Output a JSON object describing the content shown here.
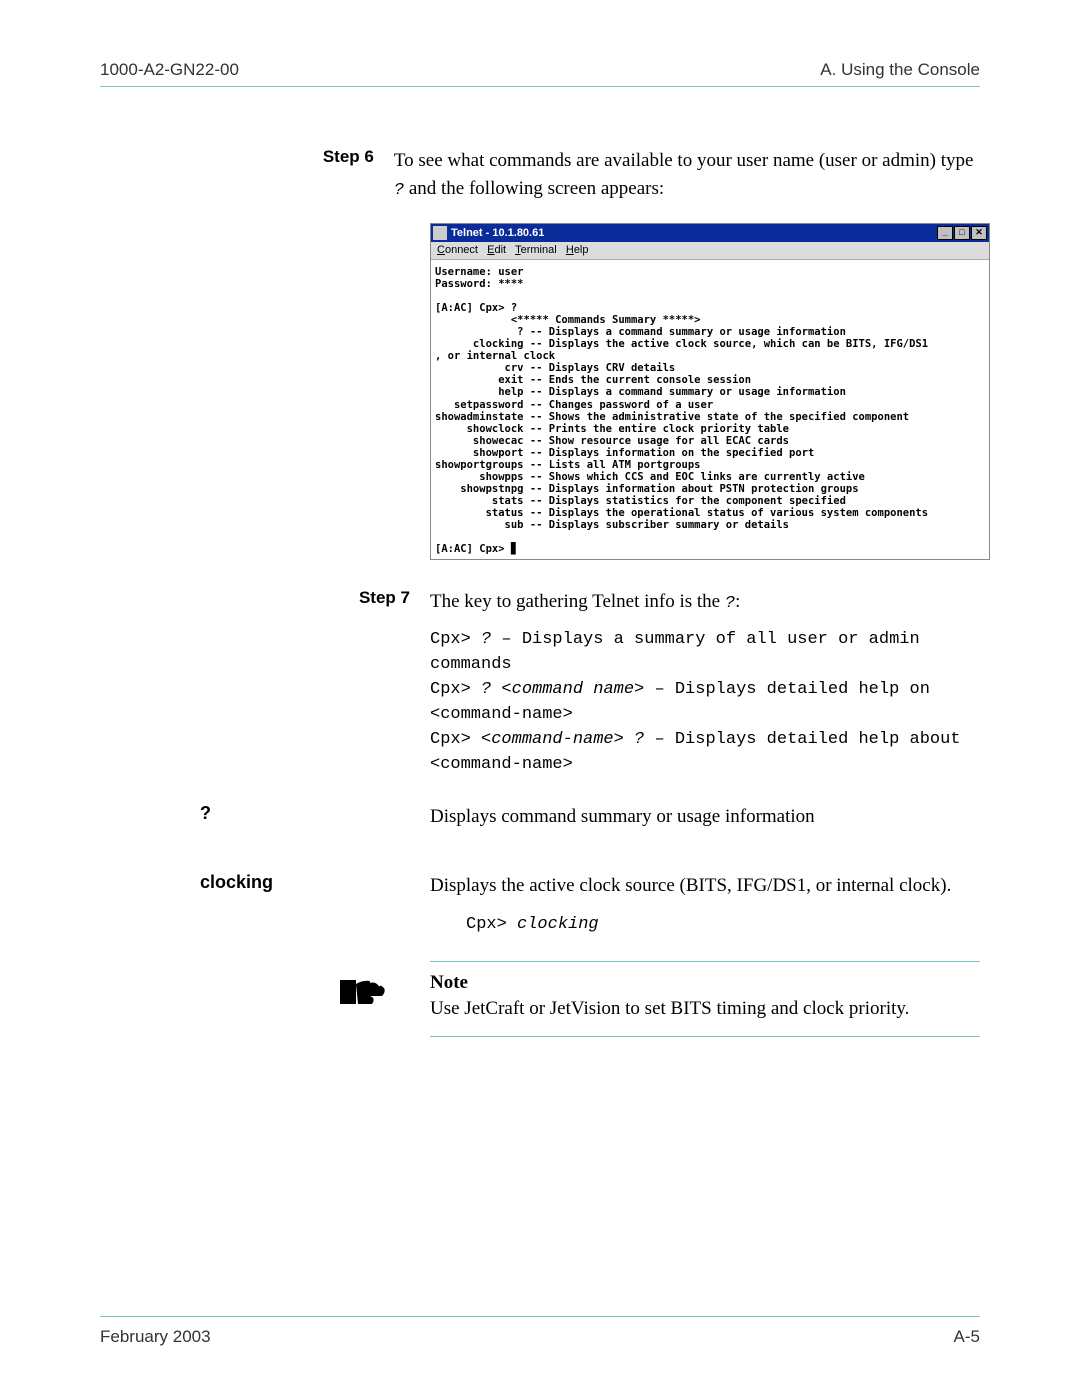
{
  "header": {
    "left": "1000-A2-GN22-00",
    "right": "A. Using the Console"
  },
  "step6": {
    "label": "Step 6",
    "text_a": "To see what commands are available to your user name (user or admin) type ",
    "q": "?",
    "text_b": " and the following screen appears:"
  },
  "telnet": {
    "title": "Telnet - 10.1.80.61",
    "menu": {
      "c": "C",
      "onnect": "onnect",
      "e": "E",
      "dit": "dit",
      "t": "T",
      "erminal": "erminal",
      "h": "H",
      "elp": "elp"
    },
    "btn_min": "_",
    "btn_max": "□",
    "btn_close": "✕",
    "body": "Username: user\nPassword: ****\n\n[A:AC] Cpx> ?\n            <***** Commands Summary *****>\n             ? -- Displays a command summary or usage information\n      clocking -- Displays the active clock source, which can be BITS, IFG/DS1\n, or internal clock\n           crv -- Displays CRV details\n          exit -- Ends the current console session\n          help -- Displays a command summary or usage information\n   setpassword -- Changes password of a user\nshowadminstate -- Shows the administrative state of the specified component\n     showclock -- Prints the entire clock priority table\n      showecac -- Show resource usage for all ECAC cards\n      showport -- Displays information on the specified port\nshowportgroups -- Lists all ATM portgroups\n       showpps -- Shows which CCS and EOC links are currently active\n    showpstnpg -- Displays information about PSTN protection groups\n         stats -- Displays statistics for the component specified\n        status -- Displays the operational status of various system components\n           sub -- Displays subscriber summary or details\n\n[A:AC] Cpx> ▊"
  },
  "step7": {
    "label": "Step 7",
    "text_a": "The key to gathering Telnet info is the ",
    "q": "?",
    "text_b": ":"
  },
  "cmds": {
    "l1a": "Cpx> ",
    "l1q": "?",
    "l1b": " – Displays a summary of all user or admin",
    "l1c": "         commands",
    "l2a": "Cpx> ",
    "l2q": "?",
    "l2s": " ",
    "l2n": "<command name>",
    "l2b": " – Displays detailed help on",
    "l2c": "                       <command-name>",
    "l3a": "Cpx> ",
    "l3n": "<command-name>",
    "l3s": " ",
    "l3q": "?",
    "l3b": " – Displays detailed help about",
    "l3c": "                       <command-name>"
  },
  "qmark": {
    "label": "?",
    "desc": "Displays command summary or usage information"
  },
  "clocking": {
    "label": "clocking",
    "desc": "Displays the active clock source (BITS, IFG/DS1, or internal clock).",
    "example_prompt": "Cpx> ",
    "example_cmd": "clocking"
  },
  "note": {
    "head": "Note",
    "body": "Use JetCraft or JetVision to set BITS timing and clock priority."
  },
  "footer": {
    "left": "February 2003",
    "right": "A-5"
  }
}
